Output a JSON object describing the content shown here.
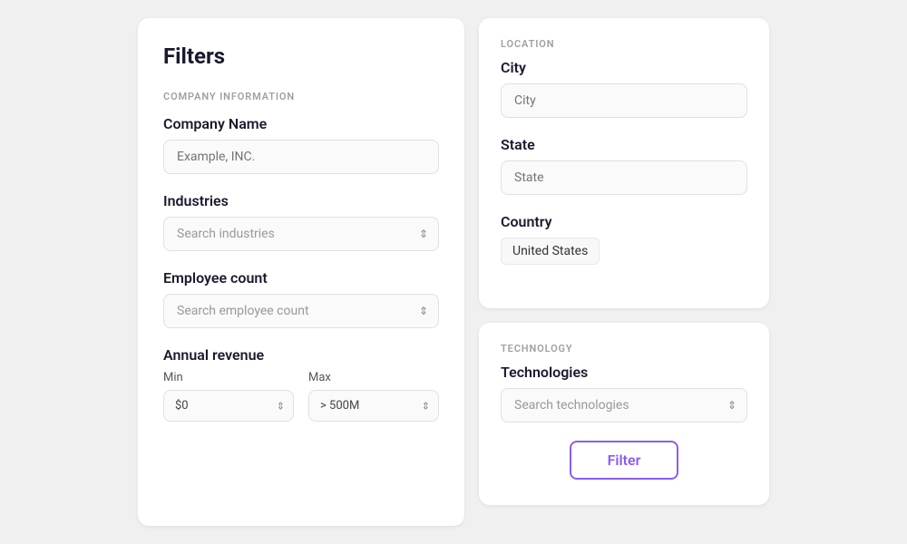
{
  "leftCard": {
    "title": "Filters",
    "companySection": {
      "label": "COMPANY INFORMATION",
      "companyName": {
        "label": "Company Name",
        "placeholder": "Example, INC."
      },
      "industries": {
        "label": "Industries",
        "placeholder": "Search industries"
      },
      "employeeCount": {
        "label": "Employee count",
        "placeholder": "Search employee count"
      },
      "annualRevenue": {
        "label": "Annual revenue",
        "min": {
          "label": "Min",
          "value": "$0"
        },
        "max": {
          "label": "Max",
          "value": "> 500M"
        }
      }
    }
  },
  "rightCardTop": {
    "locationLabel": "LOCATION",
    "city": {
      "label": "City",
      "placeholder": "City"
    },
    "state": {
      "label": "State",
      "placeholder": "State"
    },
    "country": {
      "label": "Country",
      "value": "United States"
    }
  },
  "rightCardBottom": {
    "technologyLabel": "TECHNOLOGY",
    "technologies": {
      "label": "Technologies",
      "placeholder": "Search technologies"
    },
    "filterButton": "Filter"
  }
}
